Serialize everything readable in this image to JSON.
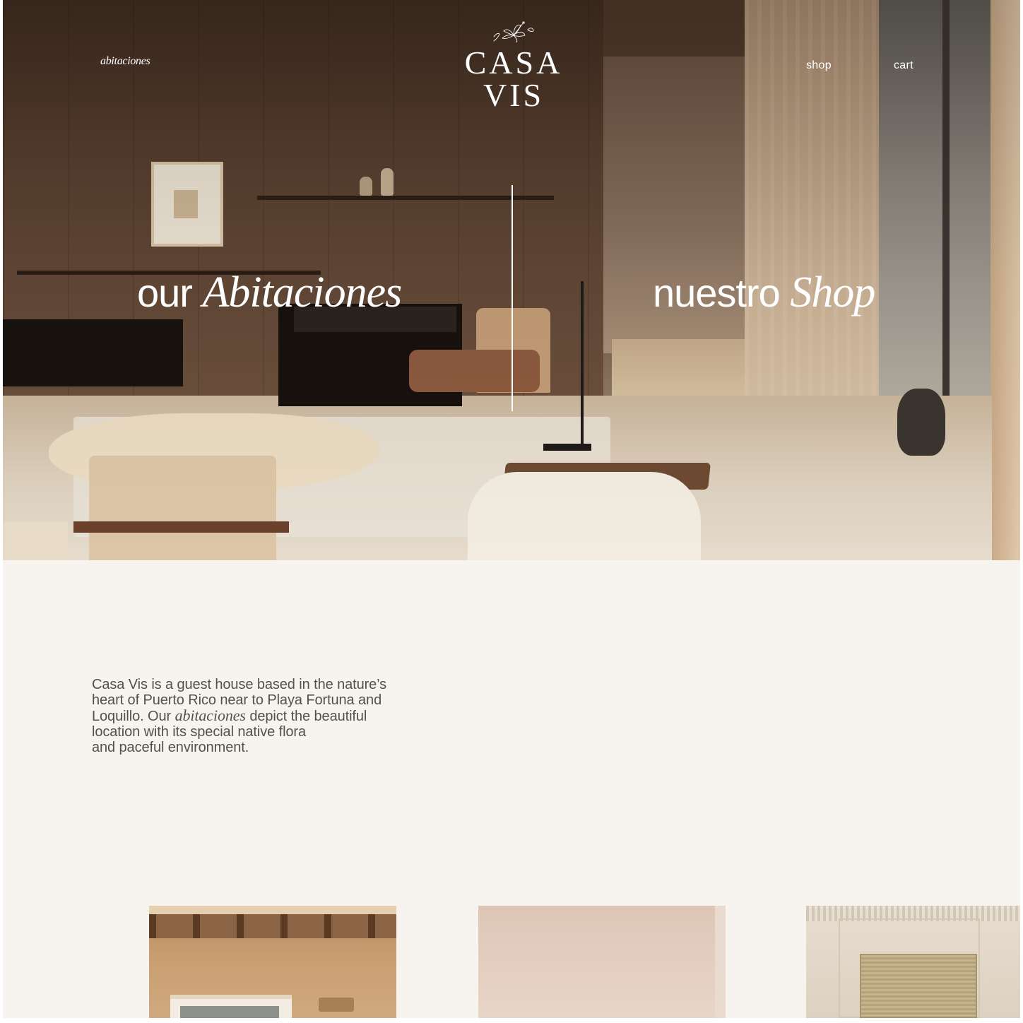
{
  "nav": {
    "left_link": "abitaciones",
    "shop": "shop",
    "cart": "cart"
  },
  "logo": {
    "text": "CASA VIS",
    "icon": "hibiscus-flower-icon"
  },
  "hero": {
    "left_heading": {
      "plain": "our",
      "italic": "Abitaciones"
    },
    "right_heading": {
      "plain": "nuestro",
      "italic": "Shop"
    }
  },
  "intro": {
    "line1": "Casa Vis is a guest house based in the nature’s",
    "line2": "heart of Puerto Rico near to Playa Fortuna and",
    "line3_before": "Loquillo. Our ",
    "line3_italic": "abitaciones",
    "line3_after": " depict the beautiful",
    "line4": "location with its special native flora",
    "line5": "and paceful environment."
  },
  "colors": {
    "page_bg": "#f7f4f0",
    "nav_text": "#ffffff",
    "body_text": "#555049"
  }
}
